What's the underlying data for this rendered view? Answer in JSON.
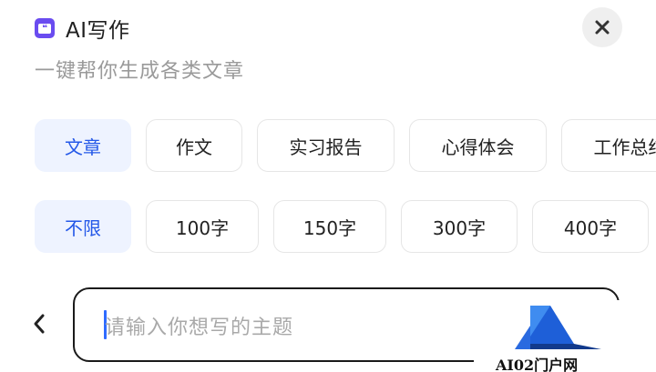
{
  "header": {
    "icon": "quote-icon",
    "title": "AI写作",
    "subtitle": "一键帮你生成各类文章"
  },
  "close_icon": "close-icon",
  "type_chips": [
    {
      "label": "文章",
      "active": true
    },
    {
      "label": "作文",
      "active": false
    },
    {
      "label": "实习报告",
      "active": false
    },
    {
      "label": "心得体会",
      "active": false
    },
    {
      "label": "工作总结",
      "active": false
    }
  ],
  "length_chips": [
    {
      "label": "不限",
      "active": true
    },
    {
      "label": "100字",
      "active": false
    },
    {
      "label": "150字",
      "active": false
    },
    {
      "label": "300字",
      "active": false
    },
    {
      "label": "400字",
      "active": false
    }
  ],
  "input": {
    "placeholder": "请输入你想写的主题",
    "value": ""
  },
  "back_icon": "chevron-left-icon",
  "watermark": {
    "text": "AI02门户网"
  },
  "colors": {
    "accent": "#2458e8",
    "active_chip_bg": "#eef3ff",
    "app_icon": "#6a4cf0",
    "caret": "#2f6bff"
  }
}
